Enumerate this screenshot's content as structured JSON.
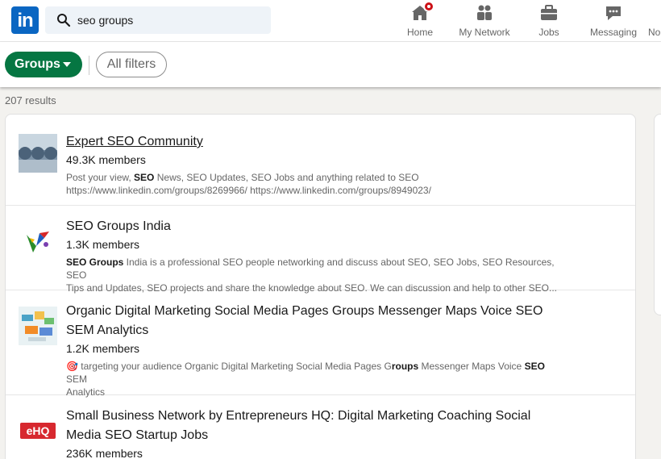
{
  "search": {
    "value": "seo groups"
  },
  "nav": [
    {
      "label": "Home",
      "icon": "home-icon"
    },
    {
      "label": "My Network",
      "icon": "network-icon"
    },
    {
      "label": "Jobs",
      "icon": "briefcase-icon"
    },
    {
      "label": "Messaging",
      "icon": "messaging-icon"
    },
    {
      "label": "No",
      "icon": "bell-icon"
    }
  ],
  "filters": {
    "groups_label": "Groups",
    "all_filters_label": "All filters"
  },
  "results_count": "207 results",
  "colors": {
    "brand": "#0a66c2",
    "groups_pill": "#057642",
    "badge": "#cc1016"
  },
  "results": [
    {
      "title": "Expert SEO Community",
      "members": "49.3K members",
      "desc_pre": "Post your view, ",
      "desc_bold": "SEO",
      "desc_post": " News, SEO Updates, SEO Jobs and anything related to SEO",
      "desc_line2": "https://www.linkedin.com/groups/8269966/ https://www.linkedin.com/groups/8949023/"
    },
    {
      "title": "SEO Groups India",
      "members": "1.3K members",
      "desc_pre": "",
      "desc_bold": "SEO Groups",
      "desc_post": " India is a professional SEO people networking and discuss about SEO, SEO Jobs, SEO Resources, SEO",
      "desc_line2": "Tips and Updates, SEO projects and share the knowledge about SEO. We can discussion and help to other SEO..."
    },
    {
      "title_line1": "Organic Digital Marketing Social Media Pages Groups Messenger Maps Voice SEO",
      "title_line2": "SEM Analytics",
      "members": "1.2K members",
      "desc_emoji": "🎯",
      "desc_pre": " targeting your audience Organic Digital Marketing Social Media Pages G",
      "desc_bold": "roups",
      "desc_mid": " Messenger Maps Voice ",
      "desc_bold2": "SEO",
      "desc_post": " SEM",
      "desc_line2": "Analytics"
    },
    {
      "title_line1": "Small Business Network by Entrepreneurs HQ: Digital Marketing Coaching Social",
      "title_line2": "Media SEO Startup Jobs",
      "members": "236K members",
      "logo_text": "eHQ"
    }
  ]
}
